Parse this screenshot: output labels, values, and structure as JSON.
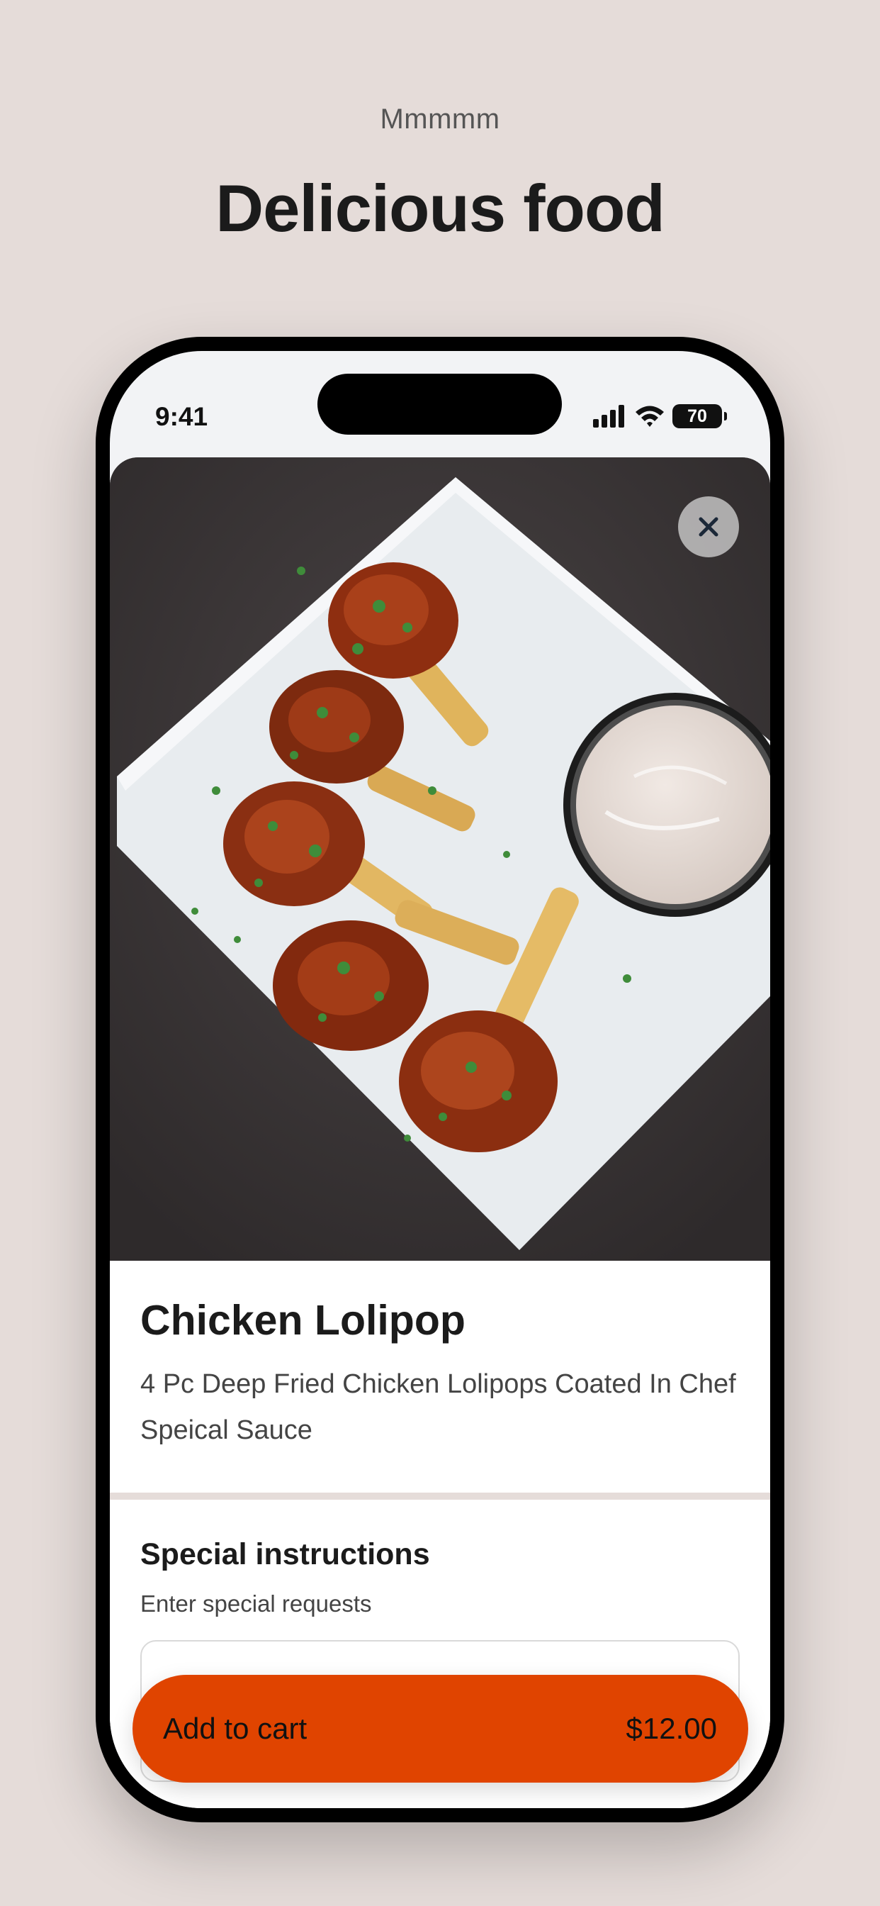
{
  "header": {
    "eyebrow": "Mmmmm",
    "headline": "Delicious food"
  },
  "status_bar": {
    "time": "9:41",
    "battery": "70",
    "icons": [
      "signal-icon",
      "wifi-icon",
      "battery-icon"
    ]
  },
  "item": {
    "image_alt": "Chicken lollipops on white plate with dipping sauce",
    "title": "Chicken Lolipop",
    "description": "4 Pc Deep Fried Chicken Lolipops Coated In Chef Speical Sauce"
  },
  "special_instructions": {
    "title": "Special instructions",
    "subtitle": "Enter special requests",
    "value": ""
  },
  "cart": {
    "label": "Add to cart",
    "price": "$12.00"
  },
  "colors": {
    "background": "#e5dcd9",
    "accent": "#e04400",
    "text": "#1b1b1b"
  }
}
